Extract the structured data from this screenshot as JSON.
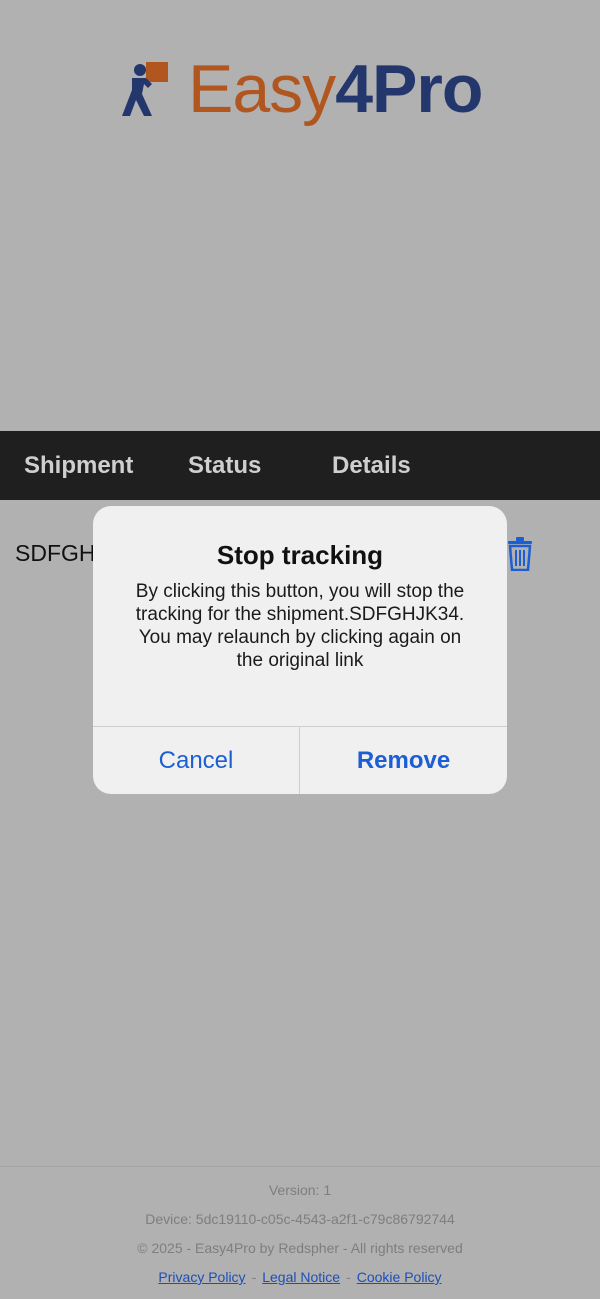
{
  "brand": {
    "part1": "Easy",
    "part2": "4Pro",
    "mark_icon": "person-with-box-icon"
  },
  "table": {
    "headers": [
      "Shipment",
      "Status",
      "Details"
    ]
  },
  "row": {
    "shipment_prefix": "SDFGH",
    "delete_icon": "trash-icon"
  },
  "dialog": {
    "title": "Stop tracking",
    "message": "By clicking this button, you will stop the tracking for the shipment.SDFGHJK34. You may relaunch by clicking again on the original link",
    "cancel": "Cancel",
    "remove": "Remove"
  },
  "footer": {
    "version": "Version: 1",
    "device": "Device: 5dc19110-c05c-4543-a2f1-c79c86792744",
    "copyright": "© 2025 - Easy4Pro by Redspher - All rights reserved",
    "links": [
      "Privacy Policy",
      "Legal Notice",
      "Cookie Policy"
    ],
    "separator": "-"
  },
  "colors": {
    "accent_blue": "#1c5fd4",
    "brand_orange": "#b2561f",
    "brand_navy": "#23376d"
  }
}
